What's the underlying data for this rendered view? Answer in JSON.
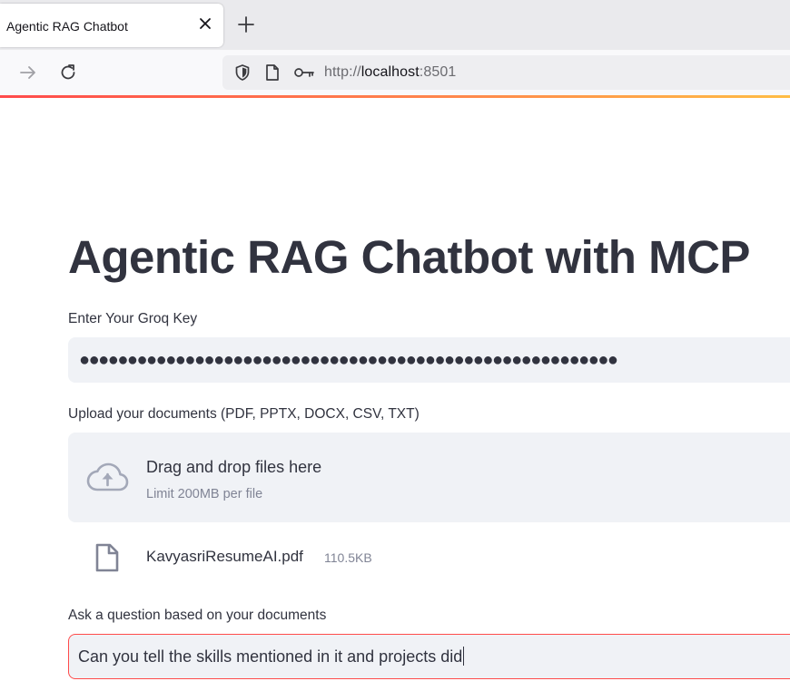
{
  "browser": {
    "tab_title": "Agentic RAG Chatbot",
    "url_scheme": "http://",
    "url_host": "localhost",
    "url_port": ":8501"
  },
  "app": {
    "title": "Agentic RAG Chatbot with MCP",
    "groq_key": {
      "label": "Enter Your Groq Key",
      "masked_value": "●●●●●●●●●●●●●●●●●●●●●●●●●●●●●●●●●●●●●●●●●●●●●●●●●●●●●●●●"
    },
    "upload": {
      "label": "Upload your documents (PDF, PPTX, DOCX, CSV, TXT)",
      "drop_title": "Drag and drop files here",
      "drop_limit": "Limit 200MB per file",
      "files": [
        {
          "name": "KavyasriResumeAI.pdf",
          "size": "110.5KB"
        }
      ]
    },
    "question": {
      "label": "Ask a question based on your documents",
      "value": "Can you tell the skills mentioned in it and projects did"
    }
  },
  "colors": {
    "accent": "#ff4b4b",
    "input_bg": "#f0f2f6",
    "text": "#31333f",
    "muted": "#808495"
  }
}
